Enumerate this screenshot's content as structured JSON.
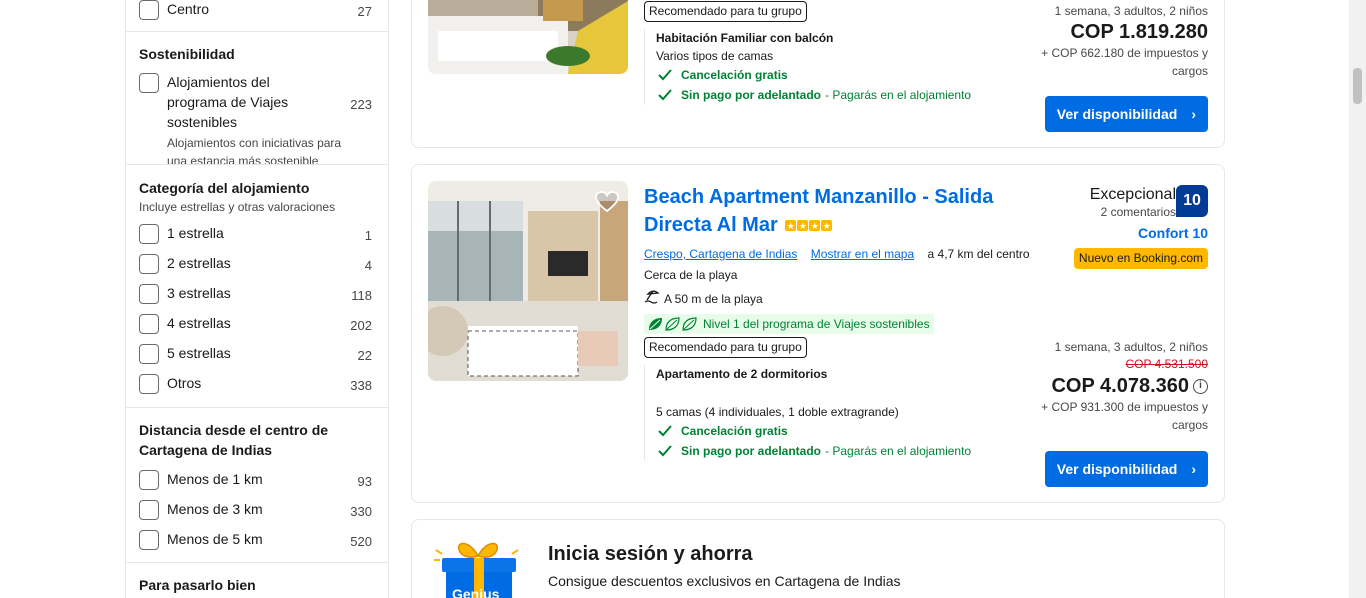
{
  "filters": {
    "centro": {
      "label": "Centro",
      "count": "27"
    },
    "sustainability": {
      "title": "Sostenibilidad",
      "item_label": "Alojamientos del programa de Viajes sostenibles",
      "item_count": "223",
      "item_desc": "Alojamientos con iniciativas para una estancia más sostenible"
    },
    "category": {
      "title": "Categoría del alojamiento",
      "subtitle": "Incluye estrellas y otras valoraciones",
      "items": [
        {
          "label": "1 estrella",
          "count": "1"
        },
        {
          "label": "2 estrellas",
          "count": "4"
        },
        {
          "label": "3 estrellas",
          "count": "118"
        },
        {
          "label": "4 estrellas",
          "count": "202"
        },
        {
          "label": "5 estrellas",
          "count": "22"
        },
        {
          "label": "Otros",
          "count": "338"
        }
      ]
    },
    "distance": {
      "title": "Distancia desde el centro de Cartagena de Indias",
      "items": [
        {
          "label": "Menos de 1 km",
          "count": "93"
        },
        {
          "label": "Menos de 3 km",
          "count": "330"
        },
        {
          "label": "Menos de 5 km",
          "count": "520"
        }
      ]
    },
    "fun": {
      "title": "Para pasarlo bien"
    }
  },
  "card1": {
    "badge": "Recomendado para tu grupo",
    "room_title": "Habitación Familiar con balcón",
    "room_sub": "Varios tipos de camas",
    "perk1": "Cancelación gratis",
    "perk2": "Sin pago por adelantado",
    "perk2_note": "- Pagarás en el alojamiento",
    "price_meta": "1 semana, 3 adultos, 2 niños",
    "price": "COP 1.819.280",
    "taxes": "+ COP 662.180 de impuestos y cargos",
    "cta": "Ver disponibilidad"
  },
  "card2": {
    "title": "Beach Apartment Manzanillo - Salida Directa Al Mar",
    "stars": 4,
    "location_link": "Crespo, Cartagena de Indias",
    "map_link": "Mostrar en el mapa",
    "distance": "a 4,7 km del centro",
    "near_beach": "Cerca de la playa",
    "beach_distance": "A 50 m de la playa",
    "sustainable": "Nivel 1 del programa de Viajes sostenibles",
    "badge": "Recomendado para tu grupo",
    "room_title": "Apartamento de 2 dormitorios",
    "room_sub": "5 camas (4 individuales, 1 doble extragrande)",
    "perk1": "Cancelación gratis",
    "perk2": "Sin pago por adelantado",
    "perk2_note": "- Pagarás en el alojamiento",
    "review_word": "Excepcional",
    "review_count": "2 comentarios",
    "score": "10",
    "comfort": "Confort 10",
    "new_badge": "Nuevo en Booking.com",
    "price_meta": "1 semana, 3 adultos, 2 niños",
    "old_price": "COP 4.531.500",
    "price": "COP 4.078.360",
    "taxes": "+ COP 931.300 de impuestos y cargos",
    "cta": "Ver disponibilidad"
  },
  "genius": {
    "title": "Inicia sesión y ahorra",
    "subtitle": "Consigue descuentos exclusivos en Cartagena de Indias",
    "logo_text": "Genius"
  },
  "colors": {
    "brand_blue": "#006ce4",
    "score_blue": "#003b95",
    "green": "#008234",
    "yellow": "#ffb700"
  }
}
